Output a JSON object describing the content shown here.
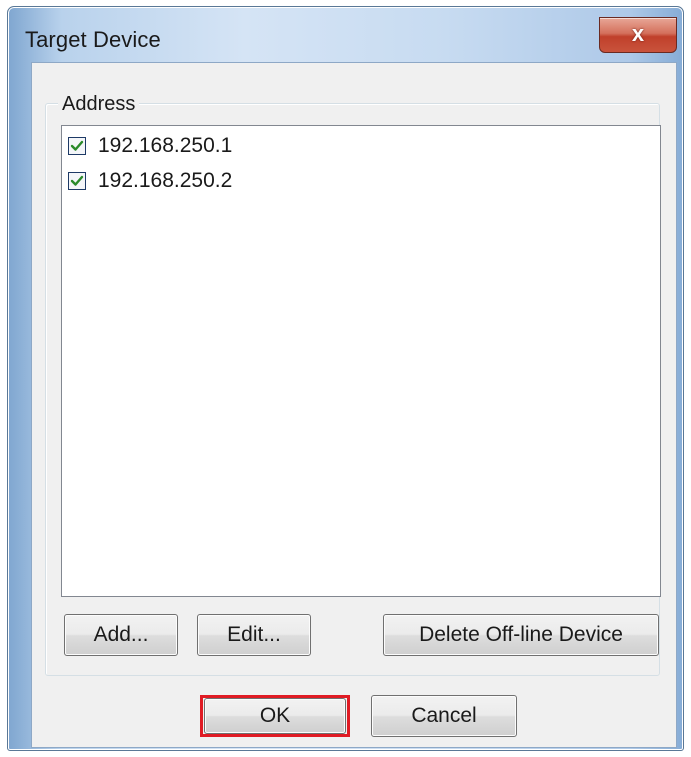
{
  "window": {
    "title": "Target Device",
    "close_glyph": "x"
  },
  "address_group": {
    "label": "Address",
    "items": [
      {
        "text": "192.168.250.1",
        "checked": true
      },
      {
        "text": "192.168.250.2",
        "checked": true
      }
    ]
  },
  "buttons": {
    "add": "Add...",
    "edit": "Edit...",
    "delete_offline": "Delete Off-line Device",
    "ok": "OK",
    "cancel": "Cancel"
  },
  "colors": {
    "highlight": "#e01b24",
    "close_button": "#c0402b"
  }
}
